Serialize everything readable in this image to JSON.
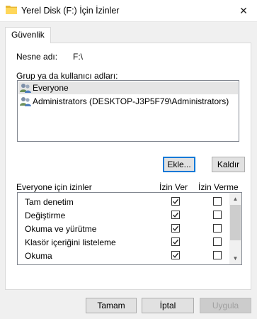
{
  "window": {
    "title": "Yerel Disk (F:) İçin İzinler",
    "close_glyph": "✕"
  },
  "tabs": [
    {
      "label": "Güvenlik"
    }
  ],
  "object": {
    "label": "Nesne adı:",
    "value": "F:\\"
  },
  "groups": {
    "label": "Grup ya da kullanıcı adları:",
    "items": [
      {
        "name": "Everyone",
        "selected": true,
        "icon": "users-icon"
      },
      {
        "name": "Administrators (DESKTOP-J3P5F79\\Administrators)",
        "selected": false,
        "icon": "users-icon"
      }
    ]
  },
  "buttons": {
    "add": "Ekle...",
    "remove": "Kaldır",
    "ok": "Tamam",
    "cancel": "İptal",
    "apply": "Uygula"
  },
  "permissions": {
    "header": "Everyone için izinler",
    "allow_label": "İzin Ver",
    "deny_label": "İzin Verme",
    "rows": [
      {
        "name": "Tam denetim",
        "allow": true,
        "deny": false
      },
      {
        "name": "Değiştirme",
        "allow": true,
        "deny": false
      },
      {
        "name": "Okuma ve yürütme",
        "allow": true,
        "deny": false
      },
      {
        "name": "Klasör içeriğini listeleme",
        "allow": true,
        "deny": false
      },
      {
        "name": "Okuma",
        "allow": true,
        "deny": false
      },
      {
        "name": "",
        "allow": true,
        "deny": false
      }
    ]
  },
  "colors": {
    "accent": "#0078d7",
    "folder": "#ffd75a"
  }
}
